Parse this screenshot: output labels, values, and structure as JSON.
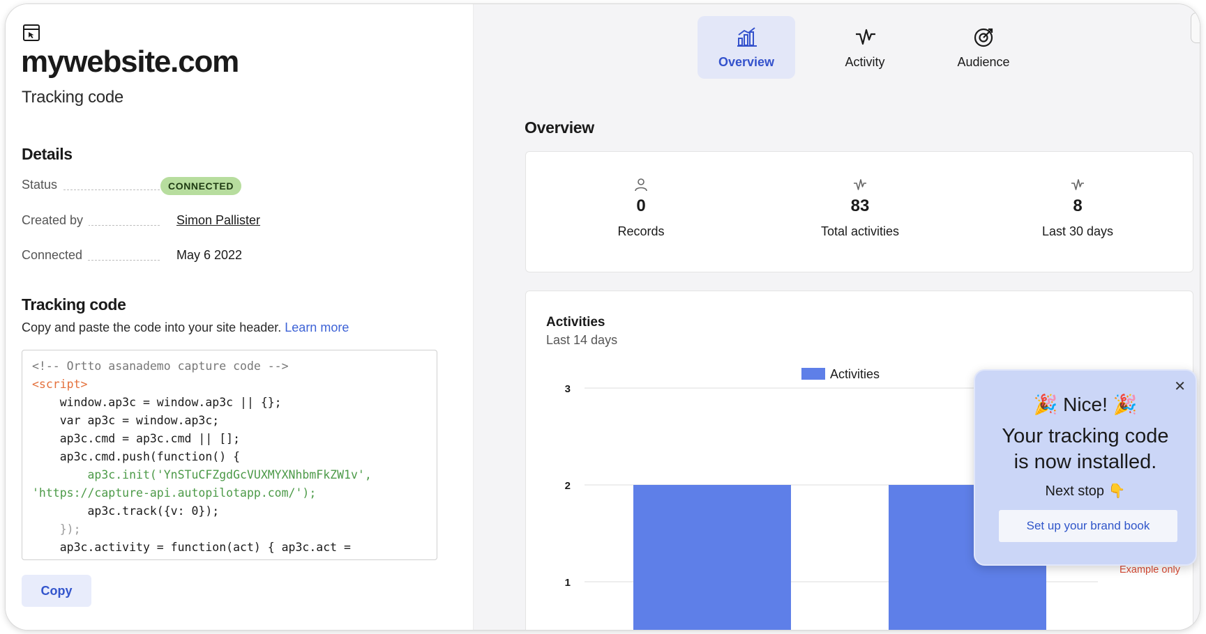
{
  "site": {
    "title": "mywebsite.com",
    "subtitle": "Tracking code",
    "icon": "browser-window-icon"
  },
  "details": {
    "heading": "Details",
    "status_label": "Status",
    "status_value": "CONNECTED",
    "created_label": "Created by",
    "created_value": "Simon Pallister",
    "connected_label": "Connected",
    "connected_value": "May 6 2022"
  },
  "tracking": {
    "heading": "Tracking code",
    "description": "Copy and paste the code into your site header.",
    "learn_more": "Learn more",
    "code_lines": [
      "<!-- Ortto asanademo capture code -->",
      "<script>",
      "    window.ap3c = window.ap3c || {};",
      "    var ap3c = window.ap3c;",
      "    ap3c.cmd = ap3c.cmd || [];",
      "    ap3c.cmd.push(function() {",
      "        ap3c.init('YnSTuCFZgdGcVUXMYXNhbmFkZW1v',",
      "'https://capture-api.autopilotapp.com/');",
      "        ap3c.track({v: 0});",
      "    });",
      "    ap3c.activity = function(act) { ap3c.act ="
    ],
    "copy_label": "Copy"
  },
  "tabs": [
    {
      "label": "Overview",
      "icon": "bar-chart-icon",
      "active": true
    },
    {
      "label": "Activity",
      "icon": "activity-pulse-icon",
      "active": false
    },
    {
      "label": "Audience",
      "icon": "target-icon",
      "active": false
    }
  ],
  "overview": {
    "heading": "Overview",
    "stats": [
      {
        "value": "0",
        "label": "Records",
        "icon": "person-icon"
      },
      {
        "value": "83",
        "label": "Total activities",
        "icon": "activity-pulse-icon"
      },
      {
        "value": "8",
        "label": "Last 30 days",
        "icon": "activity-pulse-icon"
      }
    ]
  },
  "activities_chart": {
    "title": "Activities",
    "subtitle": "Last 14 days",
    "example_note": "Example only",
    "accent": "#5e7fe8"
  },
  "chart_data": {
    "type": "bar",
    "title": "",
    "series": [
      {
        "name": "Activities",
        "values": [
          2,
          2
        ]
      }
    ],
    "categories": [
      "",
      ""
    ],
    "yticks": [
      1,
      2,
      3
    ],
    "ylim": [
      1,
      3
    ],
    "legend": "top-center",
    "grid": true
  },
  "popup": {
    "nice": "🎉 Nice! 🎉",
    "message_line1": "Your tracking code",
    "message_line2": "is now installed.",
    "next": "Next stop 👇",
    "button": "Set up your brand book",
    "close": "✕",
    "background": "#cbd6f7"
  }
}
